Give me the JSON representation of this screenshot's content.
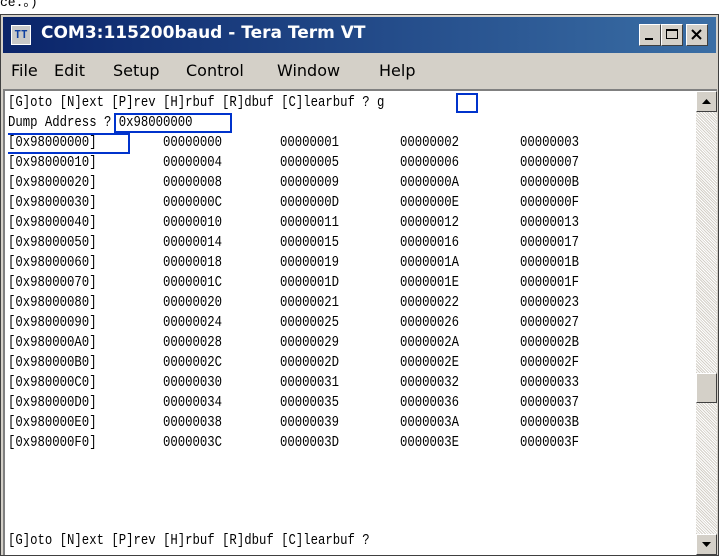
{
  "top_fragment": "ce.。)",
  "window": {
    "title": "COM3:115200baud - Tera Term VT",
    "menu": [
      "File",
      "Edit",
      "Setup",
      "Control",
      "Window",
      "Help"
    ]
  },
  "terminal": {
    "prompt_line": "[G]oto [N]ext [P]rev [H]rbuf [R]dbuf [C]learbuf ? g",
    "dump_line": "Dump Address ? 0x98000000",
    "rows": [
      [
        "[0x98000000]",
        "00000000",
        "00000001",
        "00000002",
        "00000003"
      ],
      [
        "[0x98000010]",
        "00000004",
        "00000005",
        "00000006",
        "00000007"
      ],
      [
        "[0x98000020]",
        "00000008",
        "00000009",
        "0000000A",
        "0000000B"
      ],
      [
        "[0x98000030]",
        "0000000C",
        "0000000D",
        "0000000E",
        "0000000F"
      ],
      [
        "[0x98000040]",
        "00000010",
        "00000011",
        "00000012",
        "00000013"
      ],
      [
        "[0x98000050]",
        "00000014",
        "00000015",
        "00000016",
        "00000017"
      ],
      [
        "[0x98000060]",
        "00000018",
        "00000019",
        "0000001A",
        "0000001B"
      ],
      [
        "[0x98000070]",
        "0000001C",
        "0000001D",
        "0000001E",
        "0000001F"
      ],
      [
        "[0x98000080]",
        "00000020",
        "00000021",
        "00000022",
        "00000023"
      ],
      [
        "[0x98000090]",
        "00000024",
        "00000025",
        "00000026",
        "00000027"
      ],
      [
        "[0x980000A0]",
        "00000028",
        "00000029",
        "0000002A",
        "0000002B"
      ],
      [
        "[0x980000B0]",
        "0000002C",
        "0000002D",
        "0000002E",
        "0000002F"
      ],
      [
        "[0x980000C0]",
        "00000030",
        "00000031",
        "00000032",
        "00000033"
      ],
      [
        "[0x980000D0]",
        "00000034",
        "00000035",
        "00000036",
        "00000037"
      ],
      [
        "[0x980000E0]",
        "00000038",
        "00000039",
        "0000003A",
        "0000003B"
      ],
      [
        "[0x980000F0]",
        "0000003C",
        "0000003D",
        "0000003E",
        "0000003F"
      ]
    ],
    "footer_line": "[G]oto [N]ext [P]rev [H]rbuf [R]dbuf [C]learbuf ?"
  },
  "icons": [
    "tera-term-icon",
    "minimize-icon",
    "maximize-icon",
    "close-icon",
    "scroll-up-icon",
    "scroll-down-icon"
  ],
  "colors": {
    "titlebar_start": "#0a246a",
    "titlebar_end": "#3a6ea5",
    "highlight_box": "#0033cc",
    "chrome": "#d4d0c8"
  }
}
